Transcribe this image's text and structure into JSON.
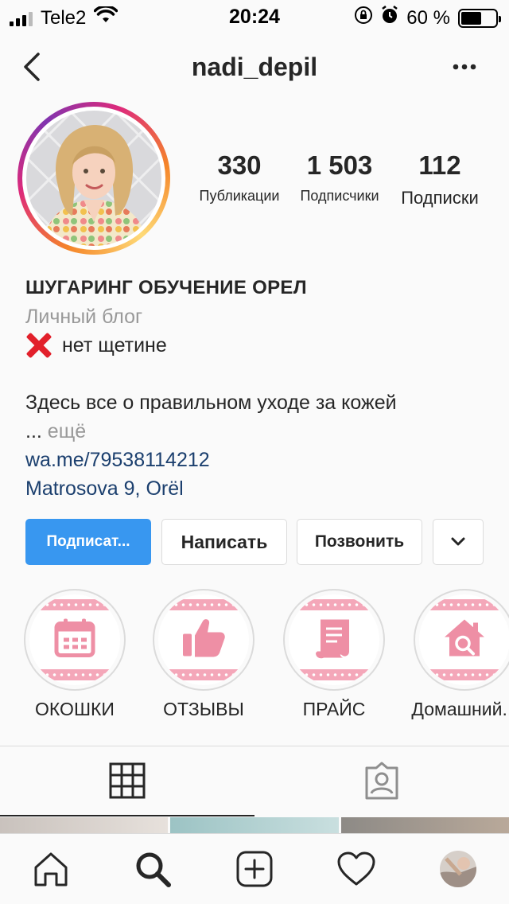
{
  "status_bar": {
    "carrier": "Tele2",
    "time": "20:24",
    "battery_percent": "60 %",
    "battery_level": 0.6
  },
  "header": {
    "username": "nadi_depil"
  },
  "stats": {
    "posts_count": "330",
    "posts_label": "Публикации",
    "followers_count": "1 503",
    "followers_label": "Подписчики",
    "following_count": "112",
    "following_label": "Подписки"
  },
  "bio": {
    "name": "ШУГАРИНГ ОБУЧЕНИЕ ОРЕЛ",
    "category": "Личный блог",
    "line1": "нет щетине",
    "line2": "Здесь все о правильном уходе за кожей",
    "ellipsis": "...",
    "more": "ещё",
    "link": "wa.me/79538114212",
    "location": "Matrosova 9, Orël"
  },
  "buttons": {
    "follow": "Подписат...",
    "message": "Написать",
    "call": "Позвонить"
  },
  "highlights": [
    {
      "label": "ОКОШКИ",
      "icon": "calendar-icon"
    },
    {
      "label": "ОТЗЫВЫ",
      "icon": "thumbs-up-icon"
    },
    {
      "label": "ПРАЙС",
      "icon": "scroll-icon"
    },
    {
      "label": "Домашний...",
      "icon": "home-search-icon"
    }
  ],
  "colors": {
    "primary_button": "#3897f0",
    "highlight_pink": "#f4a7b9",
    "link_blue": "#1b3f6e"
  }
}
